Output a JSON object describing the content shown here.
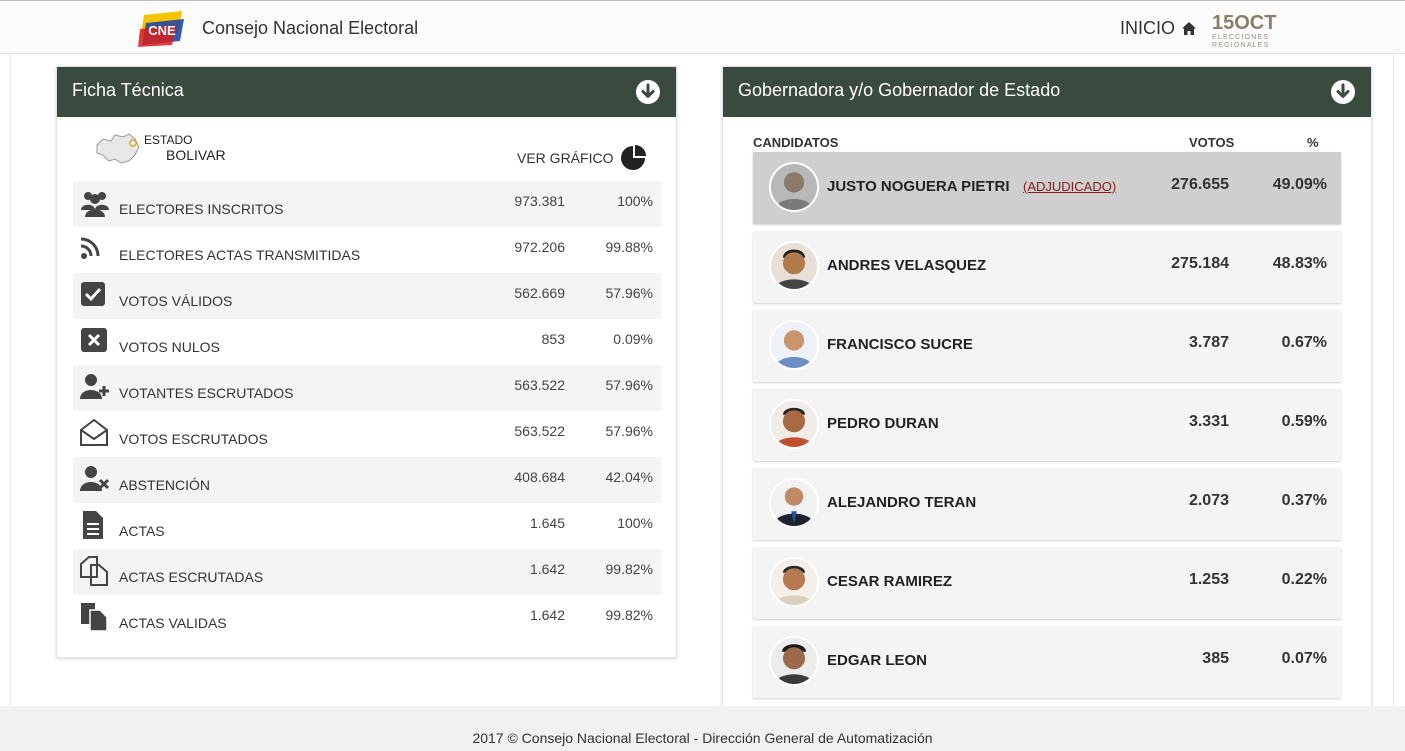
{
  "header": {
    "site_title": "Consejo Nacional Electoral",
    "nav_home": "INICIO",
    "badge_date": "15OCT",
    "badge_sub1": "ELECCIONES",
    "badge_sub2": "REGIONALES",
    "logo_text": "CNE"
  },
  "left_panel": {
    "title": "Ficha Técnica",
    "state_label": "ESTADO",
    "state_name": "BOLIVAR",
    "chart_link": "VER GRÁFICO",
    "stats": [
      {
        "icon": "users-icon",
        "label": "ELECTORES INSCRITOS",
        "value": "973.381",
        "pct": "100%"
      },
      {
        "icon": "rss-icon",
        "label": "ELECTORES ACTAS TRANSMITIDAS",
        "value": "972.206",
        "pct": "99.88%"
      },
      {
        "icon": "check-square-icon",
        "label": "VOTOS VÁLIDOS",
        "value": "562.669",
        "pct": "57.96%"
      },
      {
        "icon": "x-square-icon",
        "label": "VOTOS NULOS",
        "value": "853",
        "pct": "0.09%"
      },
      {
        "icon": "user-plus-icon",
        "label": "VOTANTES ESCRUTADOS",
        "value": "563.522",
        "pct": "57.96%"
      },
      {
        "icon": "envelope-open-icon",
        "label": "VOTOS ESCRUTADOS",
        "value": "563.522",
        "pct": "57.96%"
      },
      {
        "icon": "user-times-icon",
        "label": "ABSTENCIÓN",
        "value": "408.684",
        "pct": "42.04%"
      },
      {
        "icon": "document-icon",
        "label": "ACTAS",
        "value": "1.645",
        "pct": "100%"
      },
      {
        "icon": "copy-icon",
        "label": "ACTAS ESCRUTADAS",
        "value": "1.642",
        "pct": "99.82%"
      },
      {
        "icon": "documents-icon",
        "label": "ACTAS VALIDAS",
        "value": "1.642",
        "pct": "99.82%"
      }
    ]
  },
  "right_panel": {
    "title": "Gobernadora y/o Gobernador de Estado",
    "col_candidates": "CANDIDATOS",
    "col_votes": "VOTOS",
    "col_pct": "%",
    "candidates": [
      {
        "name": "JUSTO NOGUERA PIETRI",
        "tag": "(ADJUDICADO)",
        "votes": "276.655",
        "pct": "49.09%"
      },
      {
        "name": "ANDRES VELASQUEZ",
        "tag": "",
        "votes": "275.184",
        "pct": "48.83%"
      },
      {
        "name": "FRANCISCO SUCRE",
        "tag": "",
        "votes": "3.787",
        "pct": "0.67%"
      },
      {
        "name": "PEDRO DURAN",
        "tag": "",
        "votes": "3.331",
        "pct": "0.59%"
      },
      {
        "name": "ALEJANDRO TERAN",
        "tag": "",
        "votes": "2.073",
        "pct": "0.37%"
      },
      {
        "name": "CESAR RAMIREZ",
        "tag": "",
        "votes": "1.253",
        "pct": "0.22%"
      },
      {
        "name": "EDGAR LEON",
        "tag": "",
        "votes": "385",
        "pct": "0.07%"
      }
    ]
  },
  "footer": {
    "text": "2017 © Consejo Nacional Electoral - Dirección General de Automatización"
  },
  "colors": {
    "panel_header": "#3a4a3e",
    "row_shade": "#f4f4f4",
    "winner_row": "#cfcfcf",
    "adjudicado": "#8b1a1a"
  }
}
